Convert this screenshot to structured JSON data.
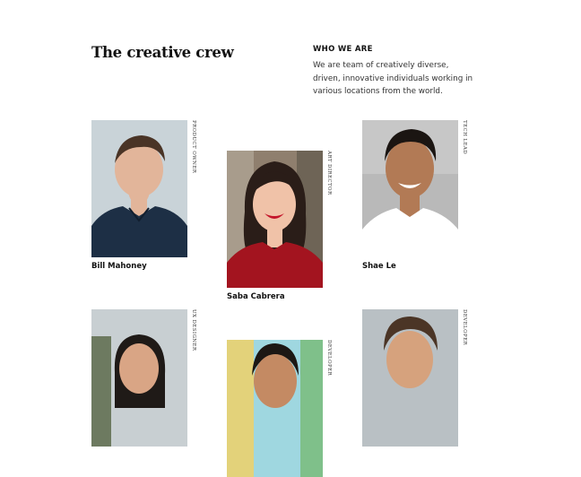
{
  "header": {
    "title": "The creative crew",
    "who_label": "WHO WE ARE",
    "who_text": "We are team of creatively diverse, driven, innovative individuals working in various locations from the world."
  },
  "team": [
    {
      "name": "Bill Mahoney",
      "role": "PRODUCT OWNER",
      "bg": "#c9d3d8",
      "skin": "#e2b59a",
      "hair": "#4a3426",
      "shirt": "#1d2f45"
    },
    {
      "name": "Saba Cabrera",
      "role": "ART DIRECTOR",
      "bg": "#8f7f6e",
      "skin": "#f0c2a8",
      "hair": "#2a1d18",
      "shirt": "#a3141f"
    },
    {
      "name": "Shae Le",
      "role": "TECH LEAD",
      "bg": "#b9b9b9",
      "skin": "#b27a55",
      "hair": "#1b1512",
      "shirt": "#ffffff"
    },
    {
      "name": "",
      "role": "UX DESIGNER",
      "bg": "#c8cfd2",
      "skin": "#d9a585",
      "hair": "#1f1a17",
      "shirt": "#3c4b55"
    },
    {
      "name": "",
      "role": "DEVELOPER",
      "bg": "#9fd7e0",
      "skin": "#c48a63",
      "hair": "#1c1714",
      "shirt": "#7a9cc0"
    },
    {
      "name": "",
      "role": "DEVELOPER",
      "bg": "#b9c0c4",
      "skin": "#d6a27d",
      "hair": "#4b3526",
      "shirt": "#5a6570"
    }
  ]
}
